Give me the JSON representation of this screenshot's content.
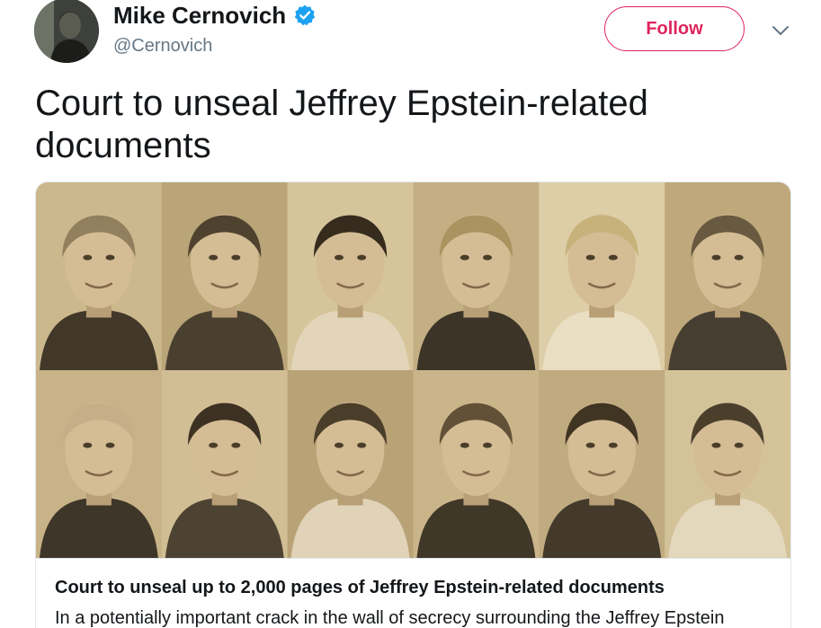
{
  "author": {
    "display_name": "Mike Cernovich",
    "handle": "@Cernovich",
    "verified": true
  },
  "actions": {
    "follow_label": "Follow",
    "menu_icon": "chevron-down-icon"
  },
  "tweet": {
    "text": "Court to unseal Jeffrey Epstein-related documents"
  },
  "card": {
    "image_description": "sepia collage of twelve portrait photos in two rows",
    "title": "Court to unseal up to 2,000 pages of Jeffrey Epstein-related documents",
    "description": "In a potentially important crack in the wall of secrecy surrounding the Jeffrey Epstein"
  },
  "colors": {
    "accent": "#e0245e",
    "verified_badge": "#1da1f2",
    "text_primary": "#14171a",
    "text_secondary": "#657786",
    "border": "#e1e8ed",
    "sepia": "#d8c9a4"
  }
}
